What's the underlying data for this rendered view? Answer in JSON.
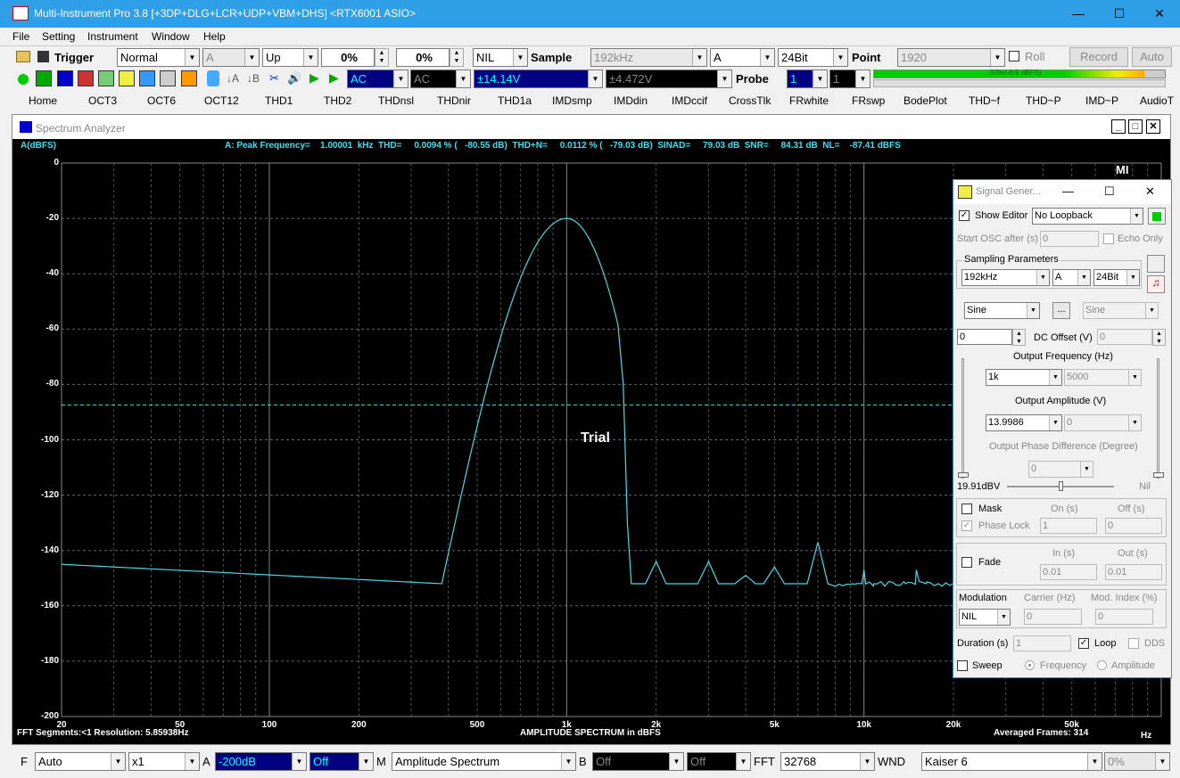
{
  "titlebar": {
    "title": "Multi-Instrument Pro 3.8    [+3DP+DLG+LCR+UDP+VBM+DHS]    <RTX6001 ASIO>",
    "minimize": "—",
    "maximize": "☐",
    "close": "✕"
  },
  "menu": [
    "File",
    "Setting",
    "Instrument",
    "Window",
    "Help"
  ],
  "toolbar1": {
    "trigger_label": "Trigger",
    "mode": "Normal",
    "channel": "A",
    "edge": "Up",
    "level1": "0%",
    "level2": "0%",
    "nil": "NIL",
    "sample_label": "Sample",
    "sample_rate": "192kHz",
    "chan2": "A",
    "bits": "24Bit",
    "point_label": "Point",
    "points": "1920",
    "roll_label": "Roll",
    "record_label": "Record",
    "auto_label": "Auto"
  },
  "toolbar2": {
    "coupling": "AC",
    "coupling2": "AC",
    "range1": "±14.14V",
    "range2": "±4.472V",
    "probe_label": "Probe",
    "probe1": "1",
    "probe2": "1",
    "level_meter_text": "93%(-0.9 dBFS)"
  },
  "tabs": [
    "Home",
    "OCT3",
    "OCT6",
    "OCT12",
    "THD1",
    "THD2",
    "THDnsl",
    "THDnir",
    "THD1a",
    "IMDsmp",
    "IMDdin",
    "IMDccif",
    "CrossTlk",
    "FRwhite",
    "FRswp",
    "BodePlot",
    "THD~f",
    "THD~P",
    "IMD~P",
    "AudioT"
  ],
  "spectrum": {
    "window_title": "Spectrum Analyzer",
    "y_unit": "A(dBFS)",
    "measurement": "A: Peak Frequency=    1.00001  kHz  THD=     0.0094 % (   -80.55 dB)  THD+N=     0.0112 % (   -79.03 dB)  SINAD=     79.03 dB  SNR=     84.31 dB  NL=    -87.41 dBFS",
    "y_ticks": [
      "0",
      "-20",
      "-40",
      "-60",
      "-80",
      "-100",
      "-120",
      "-140",
      "-160",
      "-180",
      "-200"
    ],
    "x_ticks": [
      "20",
      "50",
      "100",
      "200",
      "500",
      "1k",
      "2k",
      "5k",
      "10k",
      "20k",
      "50k"
    ],
    "x_unit": "Hz",
    "watermark": "Trial",
    "footer_left": "FFT Segments:<1    Resolution: 5.85938Hz",
    "footer_center": "AMPLITUDE SPECTRUM in dBFS",
    "footer_right": "Averaged Frames: 314",
    "trace_color": "#4fd6e6",
    "noise_level_dbfs": -87.41,
    "mi_logo": "MI"
  },
  "bottombar": {
    "f_label": "F",
    "f_value": "Auto",
    "mult": "x1",
    "a_label": "A",
    "a_value": "-200dB",
    "a_off": "Off",
    "m_label": "M",
    "m_value": "Amplitude Spectrum",
    "b_label": "B",
    "b_value": "Off",
    "b_off": "Off",
    "fft_label": "FFT",
    "fft_value": "32768",
    "wnd_label": "WND",
    "wnd_value": "Kaiser 6",
    "pct": "0%"
  },
  "siggen": {
    "title": "Signal Gener...",
    "show_editor": "Show Editor",
    "loopback": "No Loopback",
    "start_osc": "Start OSC after (s)",
    "start_osc_val": "0",
    "echo_only": "Echo Only",
    "sampling_params": "Sampling Parameters",
    "rate": "192kHz",
    "chan": "A",
    "bits": "24Bit",
    "wave1": "Sine",
    "ellipsis": "...",
    "wave2": "Sine",
    "dc_val": "0",
    "dc_label": "DC Offset (V)",
    "dc_val2": "0",
    "freq_label": "Output Frequency (Hz)",
    "freq1": "1k",
    "freq2": "5000",
    "amp_label": "Output Amplitude (V)",
    "amp1": "13.9986",
    "amp2": "0",
    "phase_label": "Output Phase Difference (Degree)",
    "phase": "0",
    "level": "19.91dBV",
    "nil": "Nil",
    "mask": "Mask",
    "on_s": "On (s)",
    "off_s": "Off (s)",
    "phase_lock": "Phase Lock",
    "on_val": "1",
    "off_val": "0",
    "fade": "Fade",
    "in_s": "In (s)",
    "out_s": "Out (s)",
    "in_val": "0.01",
    "out_val": "0.01",
    "modulation": "Modulation",
    "carrier": "Carrier (Hz)",
    "mod_index": "Mod. Index (%)",
    "mod_val": "NIL",
    "carrier_val": "0",
    "index_val": "0",
    "duration": "Duration (s)",
    "duration_val": "1",
    "loop": "Loop",
    "dds": "DDS",
    "sweep": "Sweep",
    "frequency": "Frequency",
    "amplitude": "Amplitude"
  }
}
